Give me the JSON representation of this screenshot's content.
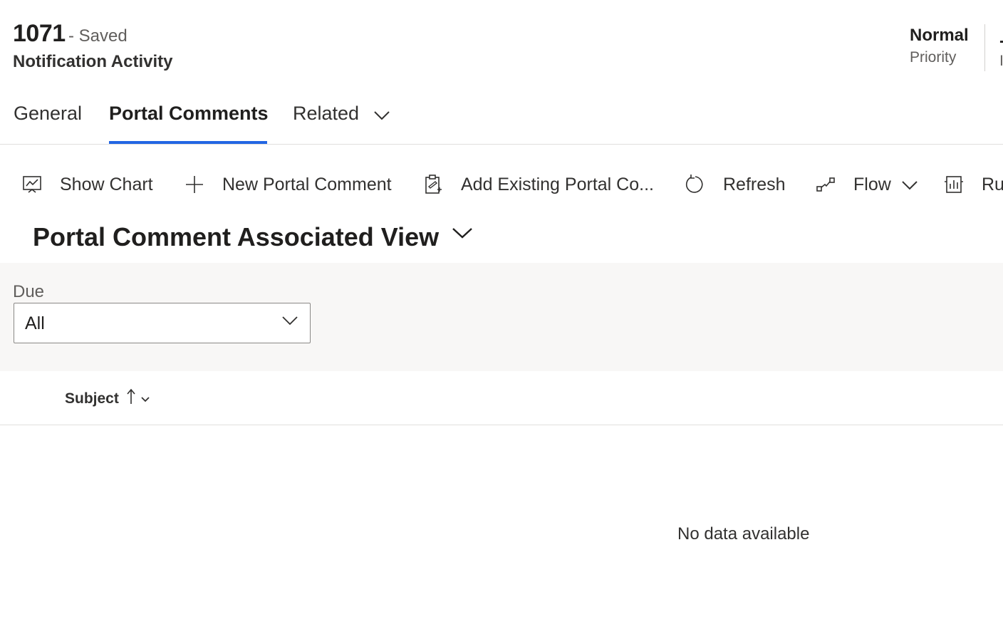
{
  "record": {
    "number": "1071",
    "saved_status": "- Saved",
    "entity": "Notification Activity"
  },
  "header_fields": [
    {
      "value": "Normal",
      "label": "Priority"
    }
  ],
  "tabs": [
    {
      "label": "General",
      "active": false
    },
    {
      "label": "Portal Comments",
      "active": true
    },
    {
      "label": "Related",
      "active": false,
      "has_dropdown": true
    }
  ],
  "commands": [
    {
      "label": "Show Chart",
      "icon": "chart-icon"
    },
    {
      "label": "New Portal Comment",
      "icon": "plus-icon"
    },
    {
      "label": "Add Existing Portal Co...",
      "icon": "clipboard-icon"
    },
    {
      "label": "Refresh",
      "icon": "refresh-icon"
    },
    {
      "label": "Flow",
      "icon": "flow-icon",
      "has_dropdown": true
    },
    {
      "label": "Ru",
      "icon": "report-icon"
    }
  ],
  "view": {
    "title": "Portal Comment Associated View"
  },
  "filter": {
    "label": "Due",
    "value": "All"
  },
  "grid": {
    "columns": [
      {
        "label": "Subject",
        "sort": "ascending"
      }
    ],
    "empty_text": "No data available"
  },
  "colors": {
    "accent": "#2266e3",
    "panel_bg": "#f8f7f6",
    "border": "#e1dfdd"
  }
}
